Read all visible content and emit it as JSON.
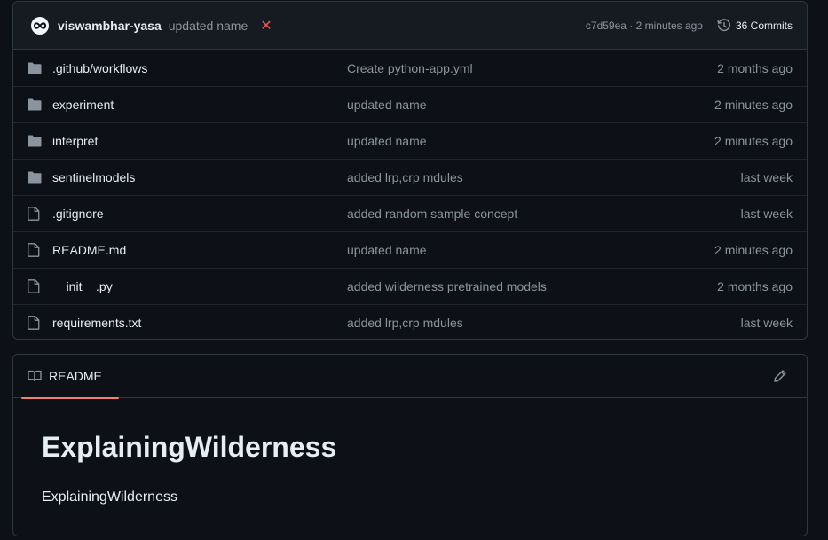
{
  "latest_commit": {
    "author": "viswambhar-yasa",
    "message": "updated name",
    "status_symbol": "✕",
    "sha_time": "c7d59ea · 2 minutes ago",
    "commits_label": "36 Commits"
  },
  "files": [
    {
      "name": ".github/workflows",
      "type": "folder",
      "commit": "Create python-app.yml",
      "time": "2 months ago"
    },
    {
      "name": "experiment",
      "type": "folder",
      "commit": "updated name",
      "time": "2 minutes ago"
    },
    {
      "name": "interpret",
      "type": "folder",
      "commit": "updated name",
      "time": "2 minutes ago"
    },
    {
      "name": "sentinelmodels",
      "type": "folder",
      "commit": "added lrp,crp mdules",
      "time": "last week"
    },
    {
      "name": ".gitignore",
      "type": "file",
      "commit": "added random sample concept",
      "time": "last week"
    },
    {
      "name": "README.md",
      "type": "file",
      "commit": "updated name",
      "time": "2 minutes ago"
    },
    {
      "name": "__init__.py",
      "type": "file",
      "commit": "added wilderness pretrained models",
      "time": "2 months ago"
    },
    {
      "name": "requirements.txt",
      "type": "file",
      "commit": "added lrp,crp mdules",
      "time": "last week"
    }
  ],
  "readme": {
    "tab_label": "README",
    "heading": "ExplainingWilderness",
    "paragraph": "ExplainingWilderness"
  },
  "colors": {
    "background": "#0d1117",
    "header_bg": "#161b22",
    "border": "#30363d",
    "muted_text": "#8b949e",
    "folder_icon": "#8b949e",
    "tab_underline": "#f78166",
    "failure": "#f85149"
  }
}
